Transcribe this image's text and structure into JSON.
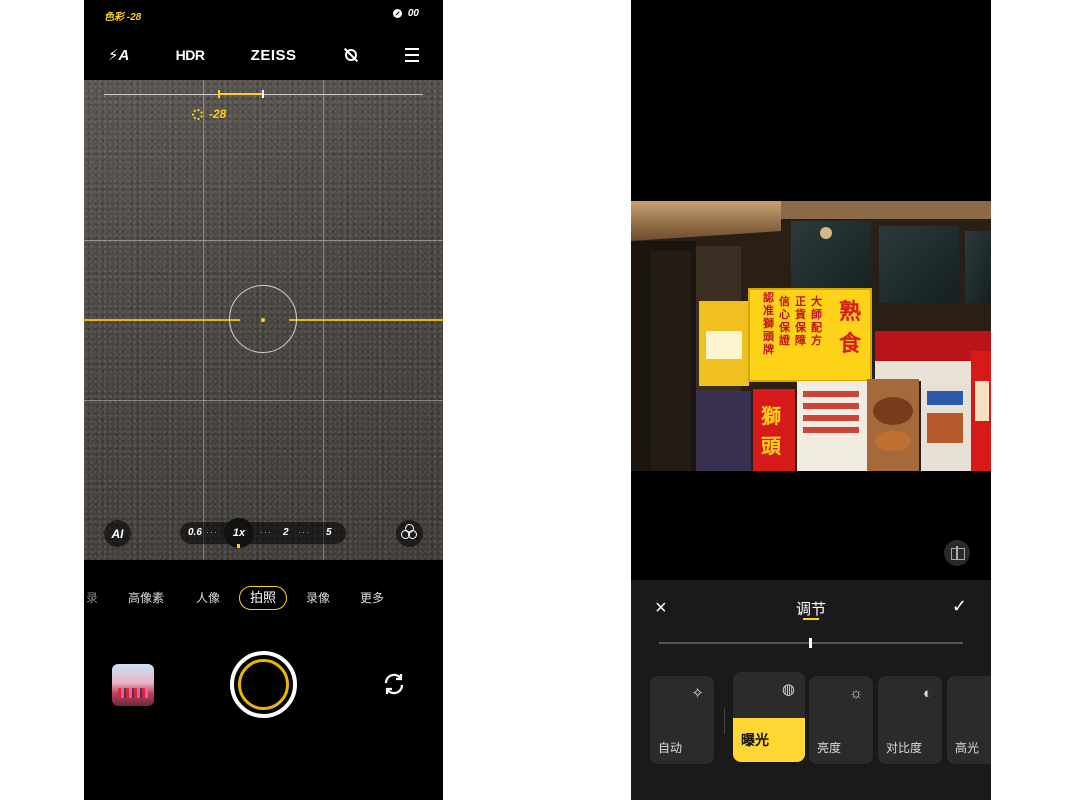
{
  "camera": {
    "status_left": "色彩 -28",
    "status_right": "00",
    "topbar": {
      "flash": "⚡A",
      "hdr": "HDR",
      "brand": "ZEISS"
    },
    "ev_value": "-28",
    "ai_label": "AI",
    "zoom": {
      "levels": [
        "0.6",
        "1x",
        "2",
        "5"
      ],
      "active": "1x"
    },
    "modes": [
      "录",
      "高像素",
      "人像",
      "拍照",
      "录像",
      "更多"
    ],
    "active_mode": "拍照"
  },
  "editor": {
    "title": "调节",
    "close_icon": "×",
    "confirm_icon": "✓",
    "slider_value": 0.5,
    "tools": [
      {
        "label": "自动",
        "icon": "magic-wand-icon"
      },
      {
        "label": "曝光",
        "icon": "exposure-icon"
      },
      {
        "label": "亮度",
        "icon": "sun-icon"
      },
      {
        "label": "对比度",
        "icon": "contrast-icon"
      },
      {
        "label": "高光",
        "icon": "highlight-icon"
      }
    ],
    "active_tool": "曝光",
    "sign": {
      "big": [
        "熟",
        "食"
      ],
      "columns": [
        "大師配方",
        "正貨保障",
        "信心保證",
        "認准獅頭牌"
      ],
      "red": [
        "獅",
        "頭"
      ]
    }
  },
  "colors": {
    "accent_yellow": "#ffcf1f",
    "panel_bg": "#1a1a1a",
    "tool_bg": "#2b2b2b"
  }
}
